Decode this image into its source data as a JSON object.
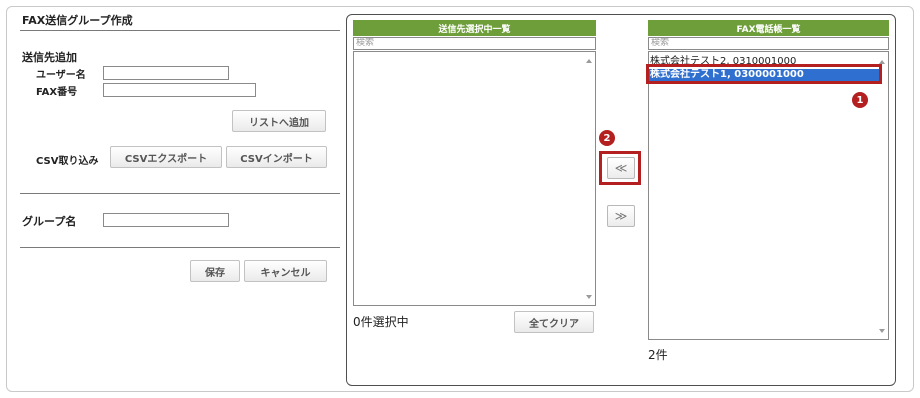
{
  "left_form": {
    "title": "FAX送信グループ作成",
    "section_add_title": "送信先追加",
    "user_name_label": "ユーザー名",
    "fax_label": "FAX番号",
    "user_name_value": "",
    "fax_value": "",
    "add_to_list_button": "リストへ追加",
    "csv_label": "CSV取り込み",
    "csv_export_button": "CSVエクスポート",
    "csv_import_button": "CSVインポート",
    "group_name_label": "グループ名",
    "group_name_value": "",
    "save_button": "保存",
    "cancel_button": "キャンセル"
  },
  "selected_list": {
    "header": "送信先選択中一覧",
    "search_placeholder": "検索",
    "items": [],
    "count_text": "0件選択中",
    "clear_button": "全てクリア"
  },
  "move_buttons": {
    "move_left": "≪",
    "move_right": "≫"
  },
  "phonebook_list": {
    "header": "FAX電話帳一覧",
    "search_placeholder": "検索",
    "items": [
      {
        "text": "株式会社テスト2, 0310001000"
      },
      {
        "text": "株式会社テスト1, 0300001000"
      }
    ],
    "count_text": "2件"
  },
  "annotations": {
    "badge1": "1",
    "badge2": "2",
    "color": "#b41f1f"
  },
  "colors": {
    "header_green": "#6e9e3a",
    "selected_blue": "#2f6fd0"
  }
}
